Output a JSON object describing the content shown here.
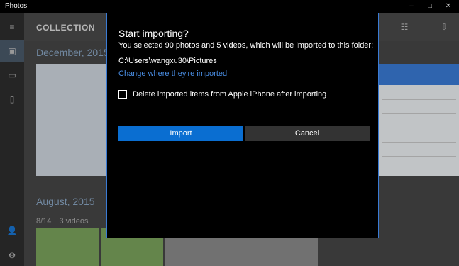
{
  "app": {
    "title": "Photos"
  },
  "window_controls": {
    "minimize": "–",
    "maximize": "□",
    "close": "✕"
  },
  "header": {
    "label": "COLLECTION"
  },
  "rail": {
    "items": [
      {
        "name": "hamburger-menu-icon",
        "glyph": "≡"
      },
      {
        "name": "collection-icon",
        "glyph": "▣"
      },
      {
        "name": "albums-icon",
        "glyph": "▭"
      },
      {
        "name": "folders-icon",
        "glyph": "▯"
      },
      {
        "name": "account-icon",
        "glyph": "👤"
      },
      {
        "name": "settings-gear-icon",
        "glyph": "⚙"
      }
    ]
  },
  "content": {
    "section1": {
      "month": "December, 2015"
    },
    "section2": {
      "month": "August, 2015",
      "date": "8/14",
      "count": "3 videos"
    }
  },
  "dialog": {
    "title": "Start importing?",
    "subtitle": "You selected 90 photos and 5 videos, which will be imported to this folder:",
    "path": "C:\\Users\\wangxu30\\Pictures",
    "change_link": "Change where they're imported",
    "checkbox_label": "Delete imported items from Apple iPhone after importing",
    "checkbox_checked": false,
    "import_label": "Import",
    "cancel_label": "Cancel"
  },
  "colors": {
    "accent": "#0a6ed1",
    "link": "#4a8fe6",
    "dialog_bg": "#000000"
  }
}
